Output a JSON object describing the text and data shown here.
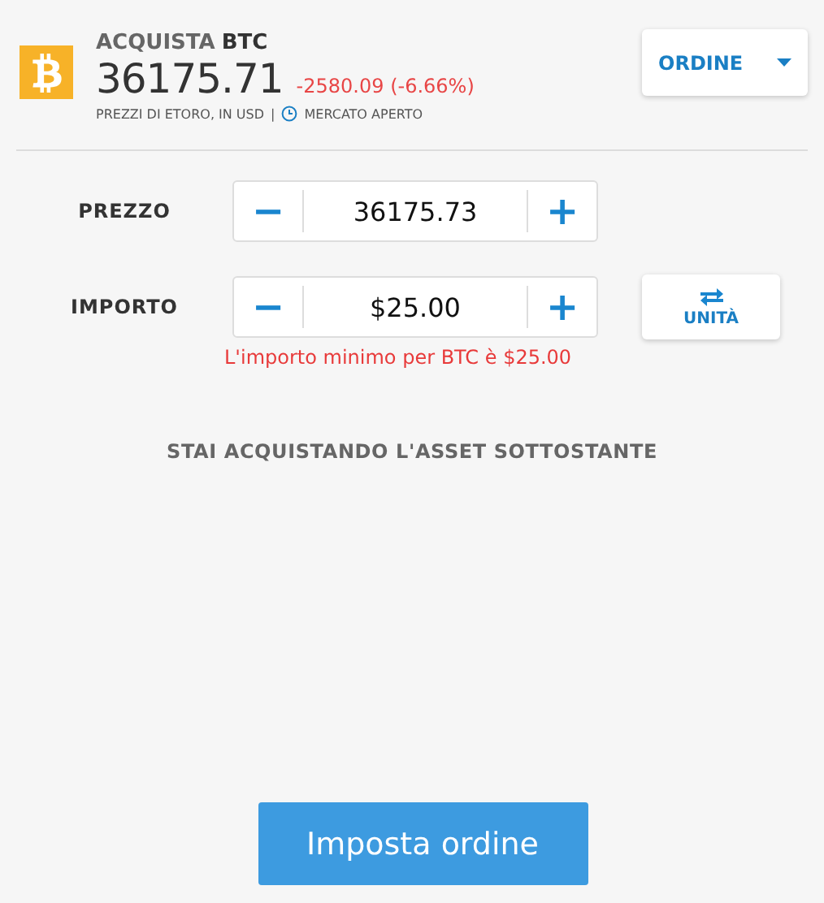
{
  "header": {
    "action": "ACQUISTA",
    "symbol": "BTC",
    "price": "36175.71",
    "change": "-2580.09 (-6.66%)",
    "source": "PREZZI DI ETORO, IN USD",
    "separator": "|",
    "market_status": "MERCATO APERTO"
  },
  "order_type": {
    "label": "ORDINE"
  },
  "fields": [
    {
      "label": "PREZZO",
      "minus": "−",
      "value": "36175.73",
      "plus": "+"
    },
    {
      "label": "IMPORTO",
      "minus": "−",
      "value": "$25.00",
      "plus": "+",
      "error": "L'importo minimo per BTC è $25.00"
    }
  ],
  "units_button": {
    "label": "UNITÀ"
  },
  "notice": "STAI ACQUISTANDO L'ASSET SOTTOSTANTE",
  "submit_button": {
    "label": "Imposta ordine"
  }
}
